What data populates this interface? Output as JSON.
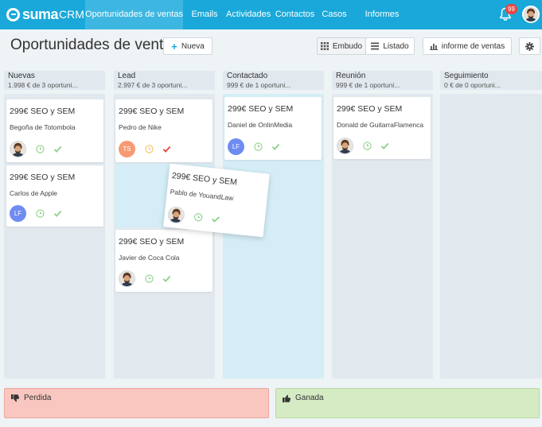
{
  "app": {
    "logo_text": "suma",
    "logo_suffix": "CRM"
  },
  "nav": {
    "tabs": [
      {
        "label": "Oportunidades de ventas",
        "active": true
      },
      {
        "label": "Emails"
      },
      {
        "label": "Actividades"
      },
      {
        "label": "Contactos"
      },
      {
        "label": "Casos"
      },
      {
        "label": "Informes"
      }
    ],
    "notifications_count": "99"
  },
  "header": {
    "title": "Oportunidades de ventas",
    "new_button": "Nueva",
    "view_funnel": "Embudo",
    "view_list": "Listado",
    "report_button": "informe de ventas"
  },
  "columns": [
    {
      "title": "Nuevas",
      "summary": "1.998 € de 3 oportuni..."
    },
    {
      "title": "Lead",
      "summary": "2.997 € de 3 oportuni..."
    },
    {
      "title": "Contactado",
      "summary": "999 € de 1 oportuni..."
    },
    {
      "title": "Reunión",
      "summary": "999 € de 1 oportuni..."
    },
    {
      "title": "Seguimiento",
      "summary": "0 € de 0 oportuni..."
    }
  ],
  "cards": {
    "nuevas_1": {
      "title": "299€ SEO y SEM",
      "contact": "Begoña de Totombola"
    },
    "nuevas_2": {
      "title": "299€ SEO y SEM",
      "contact": "Carlos de Apple",
      "owner": "LF"
    },
    "lead_1": {
      "title": "299€ SEO y SEM",
      "contact": "Pedro de Nike",
      "owner": "TS"
    },
    "lead_2": {
      "title": "299€ SEO y SEM",
      "contact": "Javier de Coca Cola"
    },
    "contactado_1": {
      "title": "299€ SEO y SEM",
      "contact": "Daniel de OnlinMedia",
      "owner": "LF"
    },
    "reunion_1": {
      "title": "299€ SEO y SEM",
      "contact": "Donald de GuitarraFlamenca"
    },
    "dragging": {
      "title": "299€ SEO y SEM",
      "contact": "Pablo de YouandLaw"
    }
  },
  "zones": {
    "lost": "Perdida",
    "won": "Ganada"
  },
  "colors": {
    "brand": "#19a8d9",
    "check_done": "#e9453f",
    "check_pending": "#8fd18a",
    "avatar_ts": "#f79a74",
    "avatar_lf": "#6f8cf2",
    "lost_zone": "#f9c7c0",
    "won_zone": "#d5ebc3"
  }
}
